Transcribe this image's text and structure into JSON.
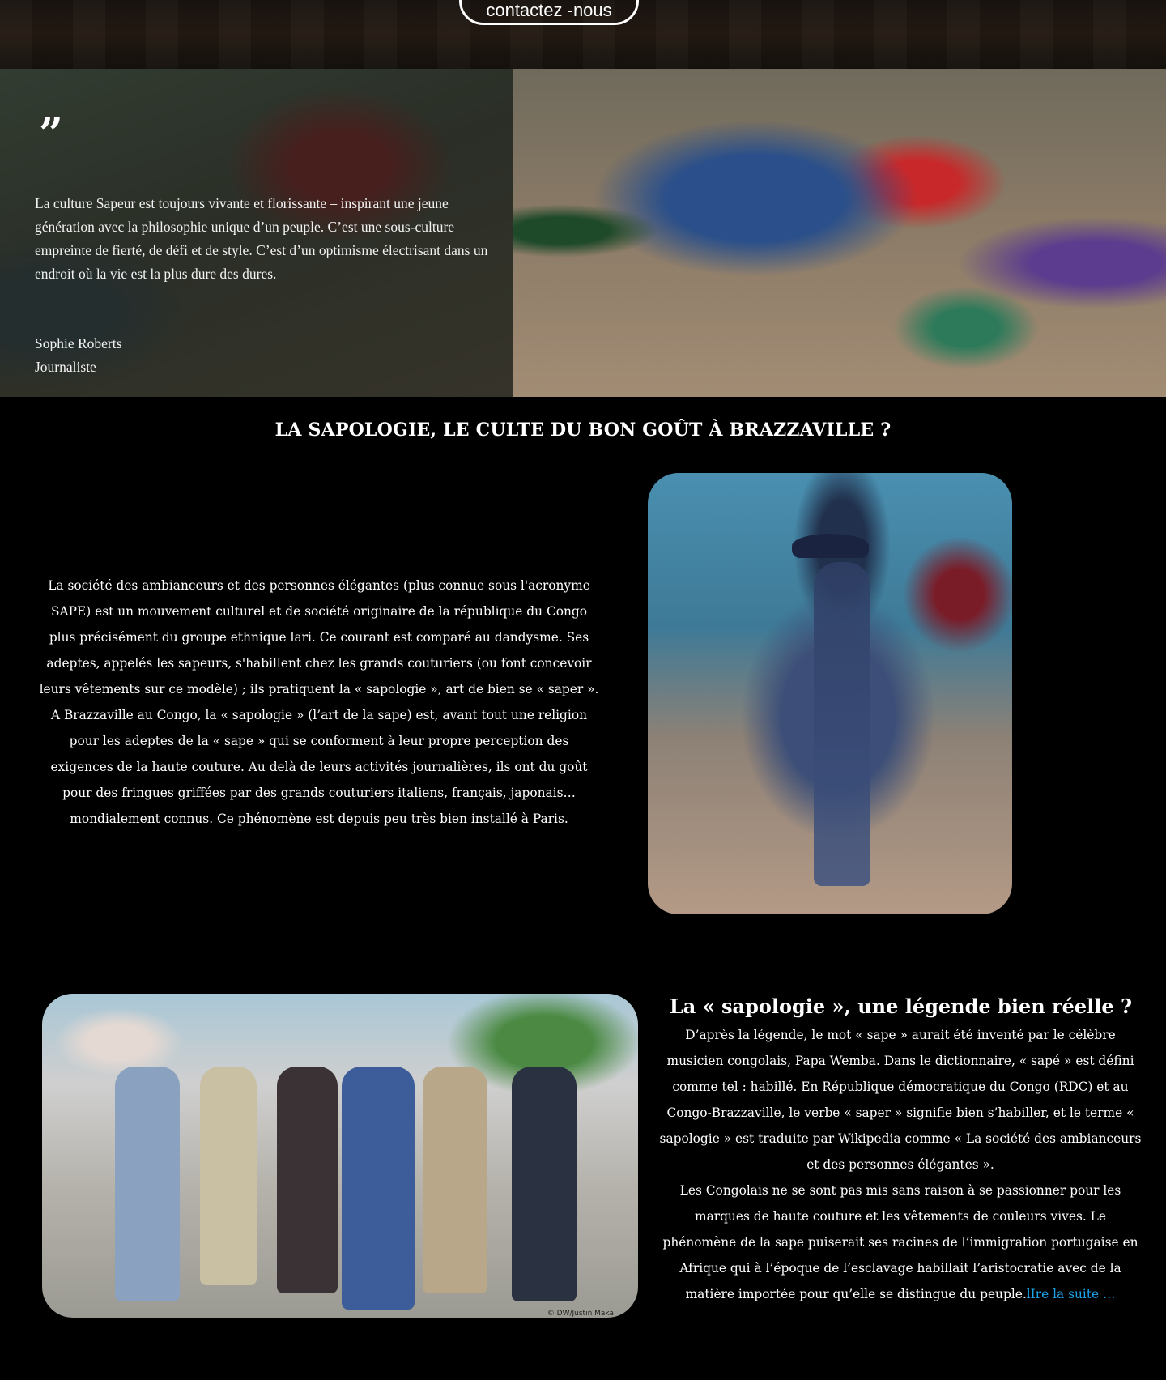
{
  "header": {
    "contact_button_label": "contactez -nous"
  },
  "hero": {
    "quote_mark": "”",
    "quote_text": "La culture Sapeur est toujours vivante et florissante – inspirant une jeune génération avec la philosophie unique d’un peuple. C’est une sous-culture empreinte de fierté, de défi et de style. C’est d’un optimisme électrisant dans un endroit où la vie est la plus dure des dures.",
    "author_name": "Sophie Roberts",
    "author_role": "Journaliste"
  },
  "section": {
    "title": "LA SAPOLOGIE, LE CULTE DU BON GOÛT À BRAZZAVILLE ?"
  },
  "block1": {
    "paragraph1": "La société des ambianceurs et des personnes élégantes (plus connue sous l'acronyme SAPE) est un mouvement culturel et de société originaire de la république du Congo plus précisément du groupe ethnique lari. Ce courant est comparé au dandysme. Ses adeptes, appelés les sapeurs, s'habillent chez les grands couturiers (ou font concevoir leurs vêtements sur ce modèle) ; ils pratiquent la « sapologie », art de bien se « saper ».",
    "paragraph2": "A Brazzaville au Congo, la « sapologie » (l’art de la sape) est, avant tout une religion pour les adeptes de la « sape » qui se conforment à leur propre perception des exigences de la haute couture. Au delà de leurs activités journalières, ils ont du goût pour des fringues griffées par des grands couturiers italiens, français, japonais… mondialement connus. Ce phénomène est depuis peu très bien installé à Paris."
  },
  "block2": {
    "title": "La « sapologie », une légende bien réelle ?",
    "paragraph1": "D’après la légende, le mot « sape » aurait été inventé par le célèbre musicien congolais, Papa Wemba. Dans le dictionnaire, « sapé » est défini comme tel : habillé. En République démocratique du Congo (RDC) et au Congo-Brazzaville, le verbe « saper » signifie bien s’habiller, et le terme « sapologie » est traduite par Wikipedia comme « La société des ambianceurs et des personnes élégantes ».",
    "paragraph2": "Les Congolais ne se sont pas mis sans raison à se passionner pour les marques de haute couture et les vêtements de couleurs vives. Le phénomène de la sape puiserait ses racines de l’immigration portugaise en Afrique qui à l’époque de l’esclavage habillait l’aristocratie avec de la matière importée pour qu’elle se distingue du peuple.",
    "read_more_label": "lIre la suite …",
    "photo_credit": "© DW/Justin Maka"
  },
  "colors": {
    "background": "#000000",
    "link": "#1aa3e8",
    "text": "#ffffff"
  }
}
